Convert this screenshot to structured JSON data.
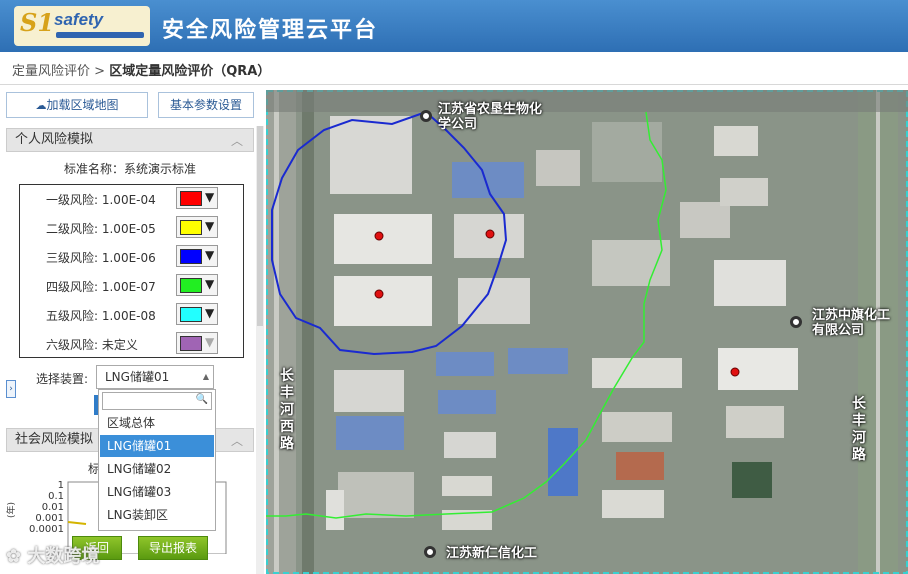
{
  "header": {
    "logo_text": "safety",
    "title": "安全风险管理云平台"
  },
  "breadcrumb": {
    "parent": "定量风险评价",
    "separator": ">",
    "current": "区域定量风险评价（QRA）"
  },
  "toolbar": {
    "load_map_label": "加载区域地图",
    "basic_params_label": "基本参数设置"
  },
  "individual_risk": {
    "title": "个人风险模拟",
    "standard_label": "标准名称：系统演示标准",
    "levels": [
      {
        "label": "一级风险: 1.00E-04",
        "color": "#ff0000"
      },
      {
        "label": "二级风险: 1.00E-05",
        "color": "#ffff00"
      },
      {
        "label": "三级风险: 1.00E-06",
        "color": "#0000ff"
      },
      {
        "label": "四级风险: 1.00E-07",
        "color": "#22ee22"
      },
      {
        "label": "五级风险: 1.00E-08",
        "color": "#22ffff"
      },
      {
        "label": "六级风险: 未定义",
        "color": "#a064b4"
      }
    ]
  },
  "device_select": {
    "label": "选择装置:",
    "selected": "LNG储罐01",
    "options": [
      "区域总体",
      "LNG储罐01",
      "LNG储罐02",
      "LNG储罐03",
      "LNG装卸区"
    ],
    "selected_index": 1
  },
  "social_risk": {
    "title": "社会风险模拟",
    "truncated_label": "标",
    "y_ticks": [
      "1",
      "0.1",
      "0.01",
      "0.001",
      "0.0001"
    ],
    "y_axis_label": "(年)"
  },
  "actions": {
    "back_label": "返回",
    "export_label": "导出报表"
  },
  "watermark": "大数跨境",
  "map": {
    "labels": [
      {
        "text": "江苏省农垦生物化学公司"
      },
      {
        "text": "江苏中旗化工有限公司"
      },
      {
        "text": "江苏新仁信化工"
      },
      {
        "text": "长丰河西路"
      },
      {
        "text": "长丰河路"
      }
    ]
  }
}
